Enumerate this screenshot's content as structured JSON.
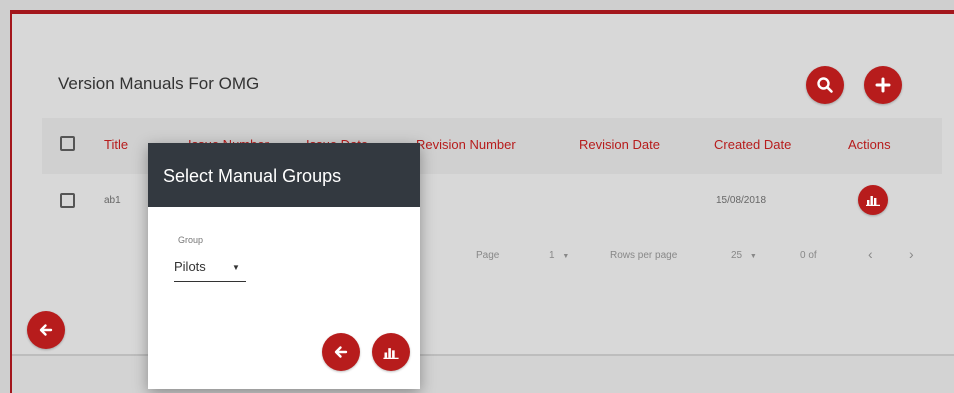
{
  "page": {
    "title": "Version Manuals For OMG"
  },
  "toolbar": {
    "search_icon": "search-icon",
    "add_icon": "plus-icon"
  },
  "table": {
    "columns": [
      "Title",
      "Issue Number",
      "Issue Date",
      "Revision Number",
      "Revision Date",
      "Created Date",
      "Actions"
    ],
    "rows": [
      {
        "title": "ab1",
        "created_date": "15/08/2018",
        "action_icon": "chart-icon"
      }
    ]
  },
  "pagination": {
    "page_label": "Page",
    "page_value": "1",
    "rows_label": "Rows per page",
    "rows_value": "25",
    "range": "0 of",
    "prev_icon": "chevron-left-icon",
    "next_icon": "chevron-right-icon"
  },
  "back_button": {
    "icon": "arrow-left-icon"
  },
  "dialog": {
    "title": "Select Manual Groups",
    "group_label": "Group",
    "group_value": "Pilots",
    "back_icon": "arrow-left-icon",
    "confirm_icon": "chart-icon"
  },
  "colors": {
    "accent": "#b71c1c",
    "dialog_header": "#333940",
    "frame_border": "#a3161c"
  }
}
